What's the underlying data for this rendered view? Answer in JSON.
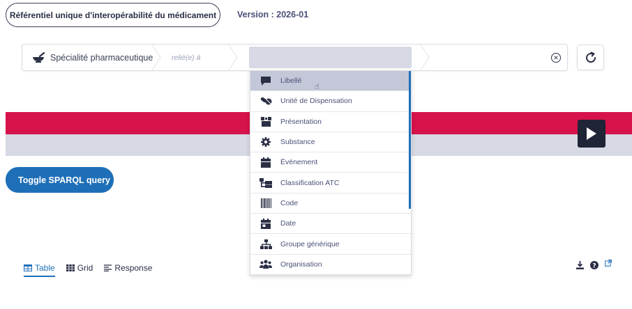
{
  "header": {
    "title": "Référentiel unique d'interopérabilité du médicament",
    "version": "Version : 2026-01"
  },
  "query": {
    "crumb1": {
      "label": "Spécialité pharmaceutique",
      "icon": "mortar-pestle-icon"
    },
    "crumb2": {
      "label": "relié(e) à"
    },
    "crumb3": {
      "value": ""
    },
    "clear_icon": "close-circle-icon",
    "refresh_icon": "refresh-icon"
  },
  "dropdown": {
    "items": [
      {
        "label": "Libellé",
        "icon": "speech-bubble-icon",
        "highlighted": true
      },
      {
        "label": "Unité de Dispensation",
        "icon": "pills-icon"
      },
      {
        "label": "Présentation",
        "icon": "box-icon"
      },
      {
        "label": "Substance",
        "icon": "cog-icon"
      },
      {
        "label": "Événement",
        "icon": "calendar-icon"
      },
      {
        "label": "Classification ATC",
        "icon": "hierarchy-icon"
      },
      {
        "label": "Code",
        "icon": "barcode-icon"
      },
      {
        "label": "Date",
        "icon": "calendar-day-icon"
      },
      {
        "label": "Groupe générique",
        "icon": "sitemap-icon"
      },
      {
        "label": "Organisation",
        "icon": "users-icon"
      }
    ]
  },
  "actions": {
    "sparql_toggle": "Toggle SPARQL query",
    "play_icon": "play-icon"
  },
  "results": {
    "tabs": [
      {
        "label": "Table",
        "icon": "table-icon",
        "active": true
      },
      {
        "label": "Grid",
        "icon": "grid-icon",
        "active": false
      },
      {
        "label": "Response",
        "icon": "lines-icon",
        "active": false
      }
    ],
    "tools": [
      "download-icon",
      "help-icon",
      "external-link-icon"
    ]
  },
  "colors": {
    "accent_red": "#d6134a",
    "accent_blue": "#1f6fb8",
    "band_grey": "#d7d9e4",
    "text_dark": "#2a2f45"
  }
}
